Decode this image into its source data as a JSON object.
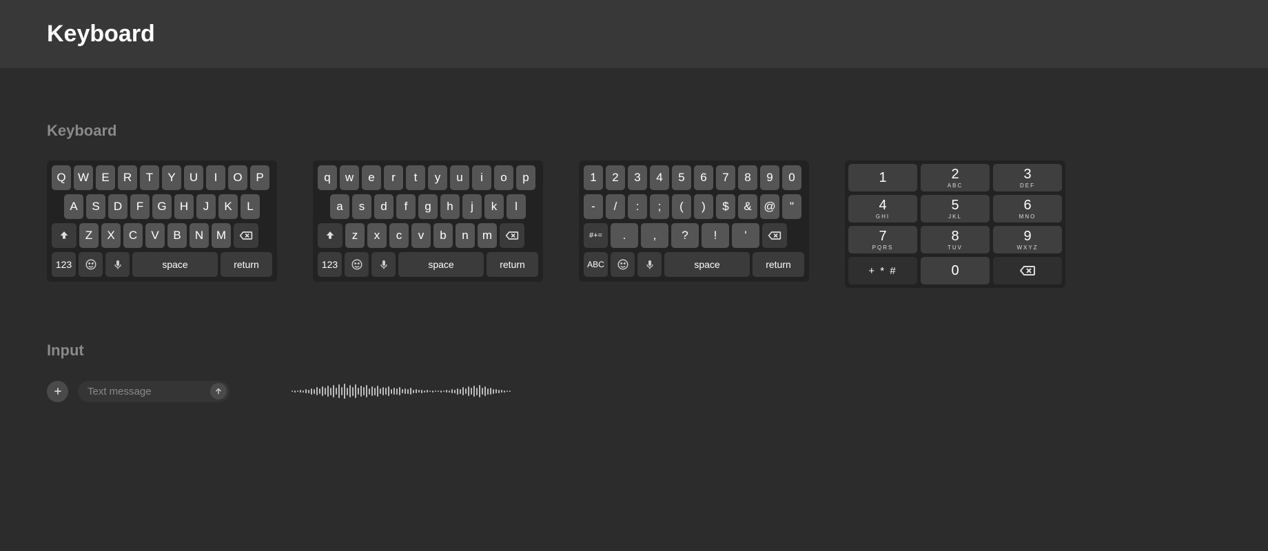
{
  "header": {
    "title": "Keyboard"
  },
  "sections": {
    "keyboard": "Keyboard",
    "input": "Input"
  },
  "kb_upper": {
    "row1": [
      "Q",
      "W",
      "E",
      "R",
      "T",
      "Y",
      "U",
      "I",
      "O",
      "P"
    ],
    "row2": [
      "A",
      "S",
      "D",
      "F",
      "G",
      "H",
      "J",
      "K",
      "L"
    ],
    "row3": [
      "Z",
      "X",
      "C",
      "V",
      "B",
      "N",
      "M"
    ],
    "mode": "123",
    "space": "space",
    "return": "return"
  },
  "kb_lower": {
    "row1": [
      "q",
      "w",
      "e",
      "r",
      "t",
      "y",
      "u",
      "i",
      "o",
      "p"
    ],
    "row2": [
      "a",
      "s",
      "d",
      "f",
      "g",
      "h",
      "j",
      "k",
      "l"
    ],
    "row3": [
      "z",
      "x",
      "c",
      "v",
      "b",
      "n",
      "m"
    ],
    "mode": "123",
    "space": "space",
    "return": "return"
  },
  "kb_sym": {
    "row1": [
      "1",
      "2",
      "3",
      "4",
      "5",
      "6",
      "7",
      "8",
      "9",
      "0"
    ],
    "row2": [
      "-",
      "/",
      ":",
      ";",
      "(",
      ")",
      "$",
      "&",
      "@",
      "\""
    ],
    "row3": [
      ".",
      ",",
      "?",
      "!",
      "'"
    ],
    "sym": "#+=",
    "abc": "ABC",
    "space": "space",
    "return": "return"
  },
  "numpad": {
    "keys": [
      [
        {
          "d": "1",
          "s": ""
        },
        {
          "d": "2",
          "s": "ABC"
        },
        {
          "d": "3",
          "s": "DEF"
        }
      ],
      [
        {
          "d": "4",
          "s": "GHI"
        },
        {
          "d": "5",
          "s": "JKL"
        },
        {
          "d": "6",
          "s": "MNO"
        }
      ],
      [
        {
          "d": "7",
          "s": "PQRS"
        },
        {
          "d": "8",
          "s": "TUV"
        },
        {
          "d": "9",
          "s": "WXYZ"
        }
      ]
    ],
    "bottom": {
      "sym": "+ * #",
      "zero": "0"
    }
  },
  "input": {
    "placeholder": "Text message"
  },
  "icons": {
    "shift": "shift-icon",
    "backspace": "backspace-icon",
    "emoji": "emoji-icon",
    "mic": "mic-icon",
    "plus": "plus-icon",
    "send": "send-up-icon"
  },
  "wave_heights": [
    2,
    3,
    2,
    4,
    3,
    6,
    5,
    9,
    7,
    12,
    8,
    14,
    10,
    16,
    11,
    18,
    10,
    20,
    12,
    22,
    11,
    18,
    13,
    20,
    10,
    16,
    12,
    18,
    9,
    14,
    11,
    16,
    8,
    12,
    10,
    14,
    7,
    10,
    9,
    12,
    6,
    8,
    7,
    10,
    5,
    6,
    4,
    5,
    3,
    4,
    2,
    3,
    2,
    2,
    3,
    2,
    4,
    3,
    6,
    5,
    9,
    7,
    12,
    8,
    14,
    10,
    16,
    11,
    18,
    10,
    14,
    9,
    10,
    7,
    6,
    5,
    4,
    3,
    2,
    2
  ]
}
